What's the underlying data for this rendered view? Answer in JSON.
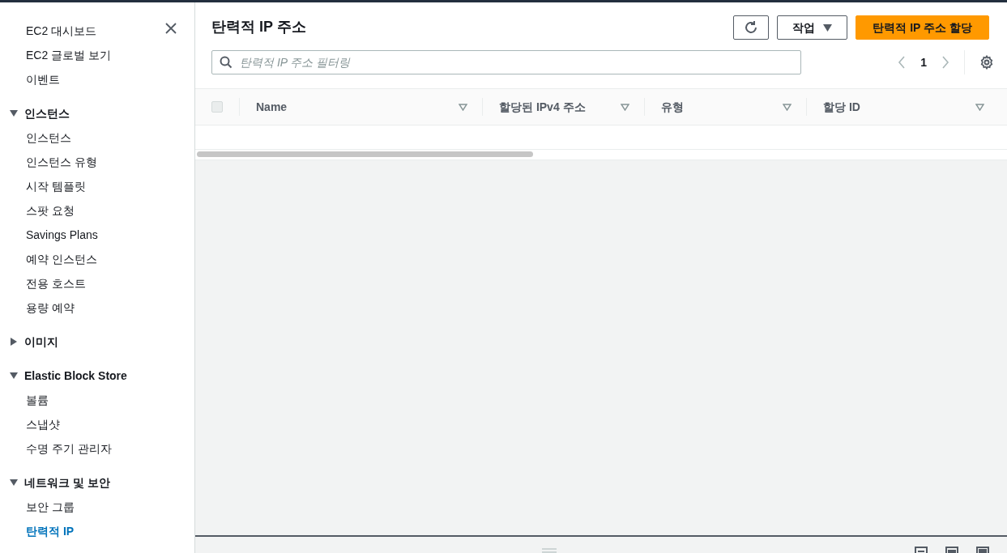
{
  "sidebar": {
    "top_links": [
      {
        "label": "EC2 대시보드",
        "selected": false
      },
      {
        "label": "EC2 글로벌 보기",
        "selected": false
      },
      {
        "label": "이벤트",
        "selected": false
      }
    ],
    "groups": [
      {
        "title": "인스턴스",
        "expanded": true,
        "items": [
          {
            "label": "인스턴스",
            "selected": false
          },
          {
            "label": "인스턴스 유형",
            "selected": false
          },
          {
            "label": "시작 템플릿",
            "selected": false
          },
          {
            "label": "스팟 요청",
            "selected": false
          },
          {
            "label": "Savings Plans",
            "selected": false
          },
          {
            "label": "예약 인스턴스",
            "selected": false
          },
          {
            "label": "전용 호스트",
            "selected": false
          },
          {
            "label": "용량 예약",
            "selected": false
          }
        ]
      },
      {
        "title": "이미지",
        "expanded": false
      },
      {
        "title": "Elastic Block Store",
        "expanded": true,
        "items": [
          {
            "label": "볼륨",
            "selected": false
          },
          {
            "label": "스냅샷",
            "selected": false
          },
          {
            "label": "수명 주기 관리자",
            "selected": false
          }
        ]
      },
      {
        "title": "네트워크 및 보안",
        "expanded": true,
        "items": [
          {
            "label": "보안 그룹",
            "selected": false
          },
          {
            "label": "탄력적 IP",
            "selected": true
          }
        ]
      }
    ]
  },
  "header": {
    "title": "탄력적 IP 주소",
    "actions_button": "작업",
    "primary_button": "탄력적 IP 주소 할당"
  },
  "filter": {
    "placeholder": "탄력적 IP 주소 필터링"
  },
  "pagination": {
    "page": "1"
  },
  "table": {
    "columns": [
      "Name",
      "할당된 IPv4 주소",
      "유형",
      "할당 ID"
    ],
    "select_all": {
      "checked": false
    }
  }
}
